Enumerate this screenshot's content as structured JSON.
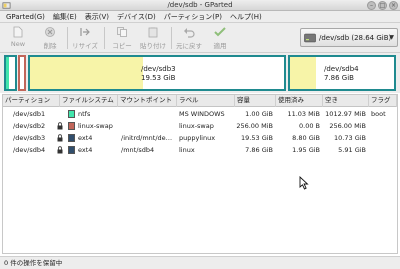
{
  "window": {
    "title": "/dev/sdb - GParted"
  },
  "menu": [
    "GParted(G)",
    "編集(E)",
    "表示(V)",
    "デバイス(D)",
    "パーティション(P)",
    "ヘルプ(H)"
  ],
  "toolbar": {
    "new": "New",
    "delete": "削除",
    "resize": "リサイズ",
    "copy": "コピー",
    "paste": "貼り付け",
    "undo": "元に戻す",
    "apply": "適用"
  },
  "device": {
    "label": "/dev/sdb  (28.64 GiB)"
  },
  "map": {
    "sdb3": {
      "name": "/dev/sdb3",
      "size": "19.53 GiB"
    },
    "sdb4": {
      "name": "/dev/sdb4",
      "size": "7.86 GiB"
    }
  },
  "table": {
    "headers": [
      "パーティション",
      "ファイルシステム",
      "マウントポイント",
      "ラベル",
      "容量",
      "使用済み",
      "空き",
      "フラグ"
    ],
    "rows": [
      {
        "partition": "/dev/sdb1",
        "fs": "ntfs",
        "mount": "",
        "label": "MS WINDOWS",
        "size": "1.00 GiB",
        "used": "11.03 MiB",
        "free": "1012.97 MiB",
        "flags": "boot",
        "fs_color": "#42e5ac",
        "locked": false
      },
      {
        "partition": "/dev/sdb2",
        "fs": "linux-swap",
        "mount": "",
        "label": "linux-swap",
        "size": "256.00 MiB",
        "used": "0.00 B",
        "free": "256.00 MiB",
        "flags": "",
        "fs_color": "#c1665a",
        "locked": true
      },
      {
        "partition": "/dev/sdb3",
        "fs": "ext4",
        "mount": "/initrd/mnt/de…",
        "label": "puppylinux",
        "size": "19.53 GiB",
        "used": "8.80 GiB",
        "free": "10.73 GiB",
        "flags": "",
        "fs_color": "#314e6c",
        "locked": true
      },
      {
        "partition": "/dev/sdb4",
        "fs": "ext4",
        "mount": "/mnt/sdb4",
        "label": "linux",
        "size": "7.86 GiB",
        "used": "1.95 GiB",
        "free": "5.91 GiB",
        "flags": "",
        "fs_color": "#314e6c",
        "locked": true
      }
    ]
  },
  "status": {
    "text": "0 件の操作を保留中"
  }
}
